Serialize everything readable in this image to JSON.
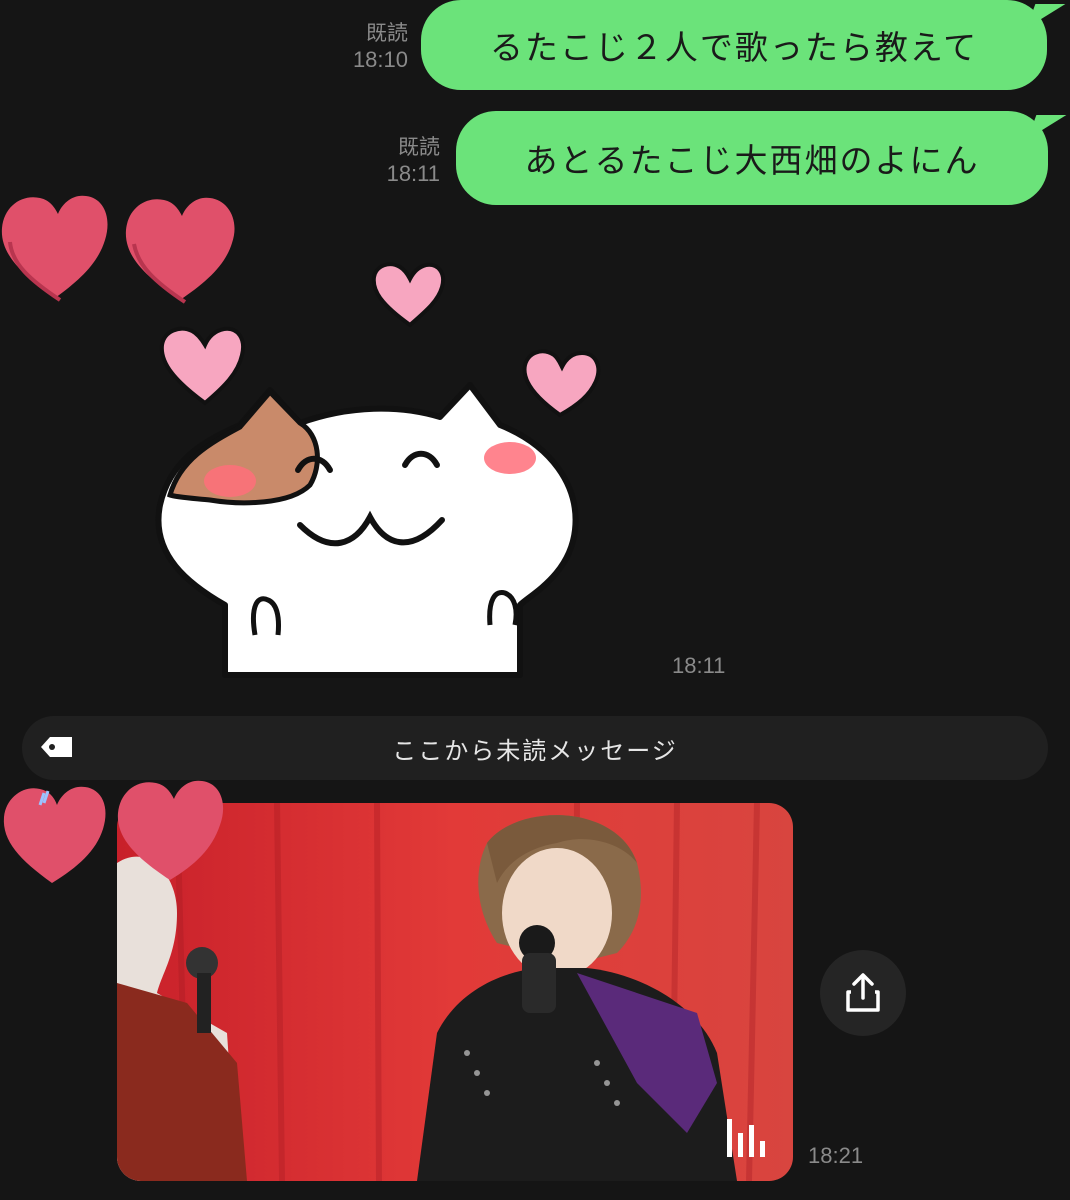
{
  "messages": [
    {
      "read": "既読",
      "time": "18:10",
      "text": "るたこじ２人で歌ったら教えて"
    },
    {
      "read": "既読",
      "time": "18:11",
      "text": "あとるたこじ大西畑のよにん"
    }
  ],
  "sticker": {
    "time": "18:11",
    "icon": "cat-hearts-sticker"
  },
  "divider": {
    "label": "ここから未読メッセージ",
    "icon": "tag-icon"
  },
  "video": {
    "time": "18:21",
    "icon": "audio-bars-icon"
  },
  "share": {
    "icon": "share-icon"
  },
  "colors": {
    "bubble": "#6be37a",
    "background": "#151515",
    "heart": "#e0506a",
    "pink_heart": "#f7a6c0"
  }
}
